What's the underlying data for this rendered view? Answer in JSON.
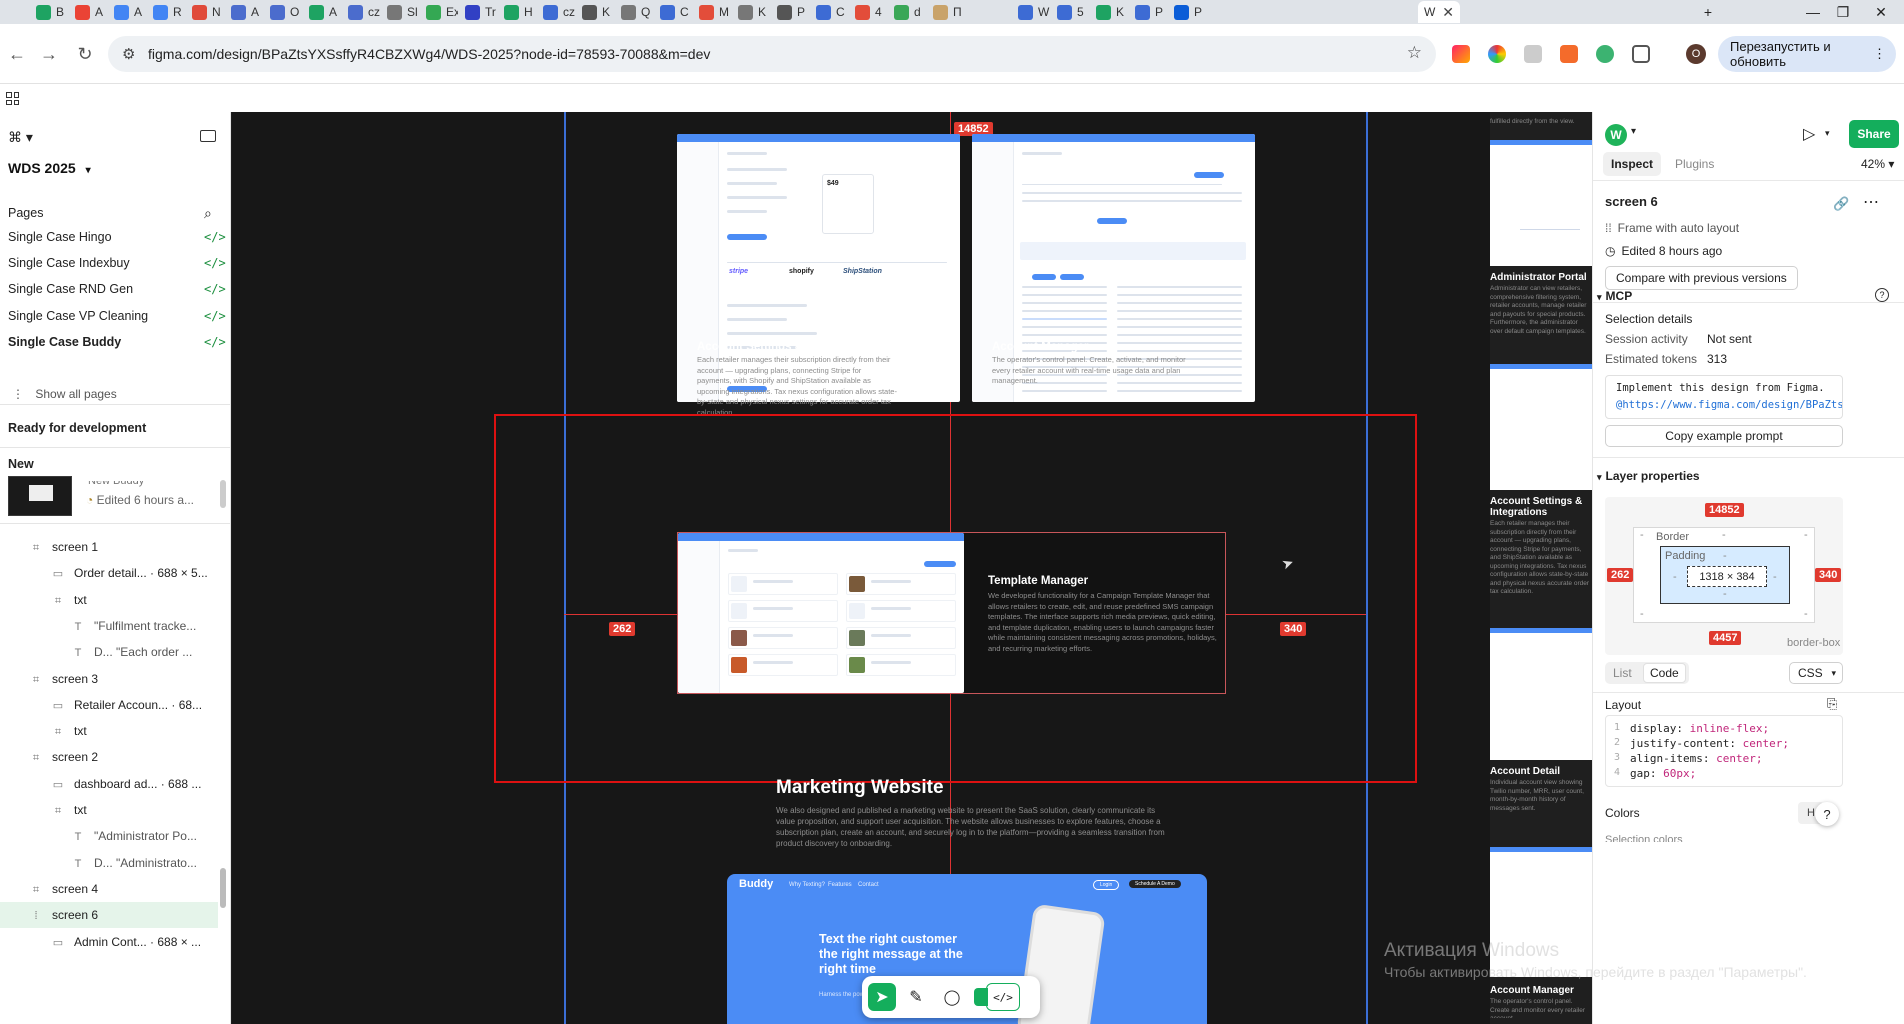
{
  "browser": {
    "tabs": [
      "B",
      "A",
      "A",
      "R",
      "N",
      "A",
      "O",
      "A",
      "cz",
      "Sl",
      "Ex",
      "Tr",
      "H",
      "cz",
      "K",
      "Q",
      "C",
      "M",
      "K",
      "P",
      "C",
      "4",
      "d",
      "П",
      "W",
      "5",
      "K",
      "P",
      "P"
    ],
    "active_tab_label": "W",
    "url": "figma.com/design/BPaZtsYXSsffyR4CBZXWg4/WDS-2025?node-id=78593-70088&m=dev",
    "relaunch_label": "Перезапустить и обновить",
    "profile_initial": "O"
  },
  "figma": {
    "file_name": "WDS 2025",
    "pages_header": "Pages",
    "pages": [
      "Single Case Hingo",
      "Single Case Indexbuy",
      "Single Case RND Gen",
      "Single Case VP Cleaning",
      "Single Case Buddy"
    ],
    "show_all_pages": "Show all pages",
    "ready_for_dev": "Ready for development",
    "new_label": "New",
    "recent": {
      "name": "New Buddy",
      "edited": "Edited 6 hours a..."
    },
    "layers": [
      {
        "label": "screen 1",
        "icon": "frame",
        "indent": 1
      },
      {
        "label": "Order detail... · 688 × 5...",
        "icon": "image",
        "indent": 2
      },
      {
        "label": "txt",
        "icon": "frame",
        "indent": 2
      },
      {
        "label": "\"Fulfilment tracke...",
        "icon": "text",
        "indent": 3
      },
      {
        "label": "D... \"Each order ...",
        "icon": "text",
        "indent": 3
      },
      {
        "label": "screen 3",
        "icon": "frame",
        "indent": 1
      },
      {
        "label": "Retailer Accoun... · 68...",
        "icon": "image",
        "indent": 2
      },
      {
        "label": "txt",
        "icon": "frame",
        "indent": 2
      },
      {
        "label": "screen 2",
        "icon": "frame",
        "indent": 1
      },
      {
        "label": "dashboard ad... · 688 ...",
        "icon": "image",
        "indent": 2
      },
      {
        "label": "txt",
        "icon": "frame",
        "indent": 2
      },
      {
        "label": "\"Administrator Po...",
        "icon": "text",
        "indent": 3
      },
      {
        "label": "D... \"Administrato...",
        "icon": "text",
        "indent": 3
      },
      {
        "label": "screen 4",
        "icon": "frame",
        "indent": 1
      },
      {
        "label": "screen 6",
        "icon": "autolayout",
        "indent": 1,
        "selected": true
      },
      {
        "label": "Admin Cont... · 688 × ...",
        "icon": "image",
        "indent": 2
      }
    ]
  },
  "canvas": {
    "measure_top": "14852",
    "measure_left": "262",
    "measure_right": "340",
    "cards": [
      {
        "title": "Account Settings & Integrations",
        "text": "Each retailer manages their subscription directly from their account — upgrading plans, connecting Stripe for payments, with Shopify and ShipStation available as upcoming integrations. Tax nexus configuration allows state-by-state and physical nexus settings for accurate order tax calculation."
      },
      {
        "title": "Account Manager",
        "text": "The operator's control panel. Create, activate, and monitor every retailer account with real-time usage data and plan management."
      },
      {
        "title": "Template Manager",
        "text": "We developed functionality for a Campaign Template Manager that allows retailers to create, edit, and reuse predefined SMS campaign templates. The interface supports rich media previews, quick editing, and template duplication, enabling users to launch campaigns faster while maintaining consistent messaging across promotions, holidays, and recurring marketing efforts."
      }
    ],
    "marketing": {
      "title": "Marketing Website",
      "text": "We also designed and published a marketing website to present the SaaS solution, clearly communicate its value proposition, and support user acquisition. The website allows businesses to explore features, choose a subscription plan, create an account, and securely log in to the platform—providing a seamless transition from product discovery to onboarding.",
      "logo": "Buddy",
      "nav": [
        "Why Texting?",
        "Features",
        "Contact"
      ],
      "login": "Login",
      "demo": "Schedule A Demo",
      "hero": "Text the right customer the right message at the right time",
      "hero_sub": "Harness the power of targeted and"
    },
    "integrations": [
      "stripe",
      "shopify",
      "ShipStation"
    ],
    "thumb_captions": [
      {
        "title": "Administrator Portal",
        "text": "Administrator can view retailers, comprehensive filtering system, retailer accounts, manage retailer and payouts for special products. Furthermore, the administrator over default campaign templates."
      },
      {
        "title": "Account Settings & Integrations",
        "text": "Each retailer manages their subscription directly from their account — upgrading plans, connecting Stripe for payments, and ShipStation available as upcoming integrations. Tax nexus configuration allows state-by-state and physical nexus accurate order tax calculation."
      },
      {
        "title": "Account Detail",
        "text": "Individual account view showing Twilio number, MRR, user count, month-by-month history of messages sent."
      },
      {
        "title": "Account Manager",
        "text": "The operator's control panel. Create and monitor every retailer account."
      }
    ],
    "thumb_top_text": "fulfilled directly from the view."
  },
  "inspect": {
    "avatar": "W",
    "share": "Share",
    "tab_inspect": "Inspect",
    "tab_plugins": "Plugins",
    "zoom": "42%",
    "selection_name": "screen 6",
    "frame_type": "Frame with auto layout",
    "edited": "Edited 8 hours ago",
    "compare": "Compare with previous versions",
    "mcp": "MCP",
    "selection_details": "Selection details",
    "session_activity_label": "Session activity",
    "session_activity_value": "Not sent",
    "tokens_label": "Estimated tokens",
    "tokens_value": "313",
    "prompt_line1": "Implement this design from Figma.",
    "prompt_line2": "@https://www.figma.com/design/BPaZtsYX...",
    "copy_prompt": "Copy example prompt",
    "layer_properties": "Layer properties",
    "box_top": "14852",
    "box_left": "262",
    "box_right": "340",
    "box_bottom": "4457",
    "border_label": "Border",
    "padding_label": "Padding",
    "dash": "-",
    "size": "1318 × 384",
    "box_sizing": "border-box",
    "view_list": "List",
    "view_code": "Code",
    "lang": "CSS",
    "layout_label": "Layout",
    "css": [
      {
        "n": "1",
        "prop": "display:",
        "val": "inline-flex;"
      },
      {
        "n": "2",
        "prop": "justify-content:",
        "val": "center;"
      },
      {
        "n": "3",
        "prop": "align-items:",
        "val": "center;"
      },
      {
        "n": "4",
        "prop": "gap:",
        "val": "60px;"
      }
    ],
    "colors_label": "Colors",
    "selection_colors": "Selection colors",
    "help": "?"
  },
  "watermark": {
    "line1": "Активация Windows",
    "line2": "Чтобы активировать Windows, перейдите в раздел \"Параметры\"."
  },
  "colors": {
    "accent": "#0d99ff",
    "measure_red": "#e03a2f",
    "share_green": "#14ae5c",
    "figma_blue": "#4b8cf5"
  }
}
